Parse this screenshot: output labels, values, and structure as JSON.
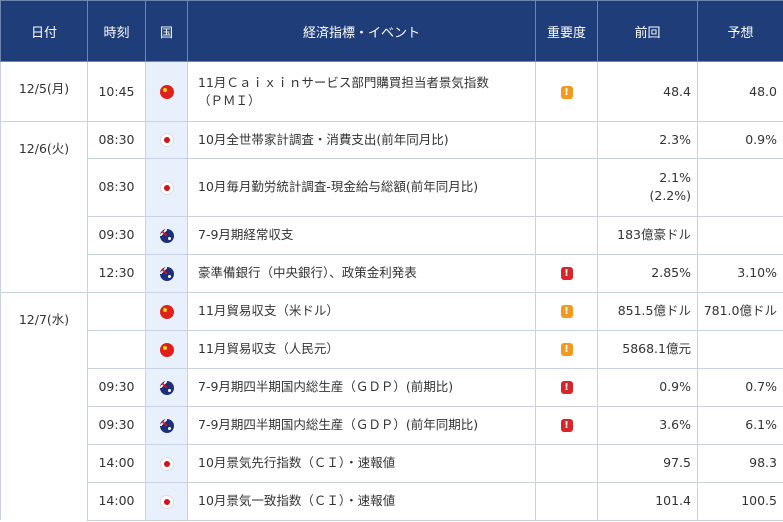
{
  "headers": {
    "date": "日付",
    "time": "時刻",
    "country": "国",
    "event": "経済指標・イベント",
    "importance": "重要度",
    "previous": "前回",
    "forecast": "予想"
  },
  "icons": {
    "importance_mark": "!",
    "importance_colors": {
      "mid": "#f39a1e",
      "high": "#d9242a"
    },
    "flags": {
      "cn": "china-flag-icon",
      "jp": "japan-flag-icon",
      "au": "australia-flag-icon"
    }
  },
  "rows": [
    {
      "date": "12/5(月)",
      "time": "10:45",
      "country": "cn",
      "event_line1": "11月Ｃａｉｘｉｎサービス部門購買担当者景気指数",
      "event_line2": "（ＰＭＩ）",
      "importance": "mid",
      "previous": "48.4",
      "previous_line2": "",
      "forecast": "48.0"
    },
    {
      "date": "12/6(火)",
      "time": "08:30",
      "country": "jp",
      "event_line1": "10月全世帯家計調査・消費支出(前年同月比)",
      "event_line2": "",
      "importance": "",
      "previous": "2.3%",
      "previous_line2": "",
      "forecast": "0.9%"
    },
    {
      "date": "",
      "time": "08:30",
      "country": "jp",
      "event_line1": "10月毎月勤労統計調査-現金給与総額(前年同月比)",
      "event_line2": "",
      "importance": "",
      "previous": "2.1%",
      "previous_line2": "(2.2%)",
      "forecast": ""
    },
    {
      "date": "",
      "time": "09:30",
      "country": "au",
      "event_line1": "7-9月期経常収支",
      "event_line2": "",
      "importance": "",
      "previous": "183億豪ドル",
      "previous_line2": "",
      "forecast": ""
    },
    {
      "date": "",
      "time": "12:30",
      "country": "au",
      "event_line1": "豪準備銀行（中央銀行）、政策金利発表",
      "event_line2": "",
      "importance": "high",
      "previous": "2.85%",
      "previous_line2": "",
      "forecast": "3.10%"
    },
    {
      "date": "12/7(水)",
      "time": "",
      "country": "cn",
      "event_line1": "11月貿易収支（米ドル）",
      "event_line2": "",
      "importance": "mid",
      "previous": "851.5億ドル",
      "previous_line2": "",
      "forecast": "781.0億ドル"
    },
    {
      "date": "",
      "time": "",
      "country": "cn",
      "event_line1": "11月貿易収支（人民元）",
      "event_line2": "",
      "importance": "mid",
      "previous": "5868.1億元",
      "previous_line2": "",
      "forecast": ""
    },
    {
      "date": "",
      "time": "09:30",
      "country": "au",
      "event_line1": "7-9月期四半期国内総生産（ＧＤＰ）(前期比)",
      "event_line2": "",
      "importance": "high",
      "previous": "0.9%",
      "previous_line2": "",
      "forecast": "0.7%"
    },
    {
      "date": "",
      "time": "09:30",
      "country": "au",
      "event_line1": "7-9月期四半期国内総生産（ＧＤＰ）(前年同期比)",
      "event_line2": "",
      "importance": "high",
      "previous": "3.6%",
      "previous_line2": "",
      "forecast": "6.1%"
    },
    {
      "date": "",
      "time": "14:00",
      "country": "jp",
      "event_line1": "10月景気先行指数（ＣＩ）・速報値",
      "event_line2": "",
      "importance": "",
      "previous": "97.5",
      "previous_line2": "",
      "forecast": "98.3"
    },
    {
      "date": "",
      "time": "14:00",
      "country": "jp",
      "event_line1": "10月景気一致指数（ＣＩ）・速報値",
      "event_line2": "",
      "importance": "",
      "previous": "101.4",
      "previous_line2": "",
      "forecast": "100.5"
    }
  ]
}
